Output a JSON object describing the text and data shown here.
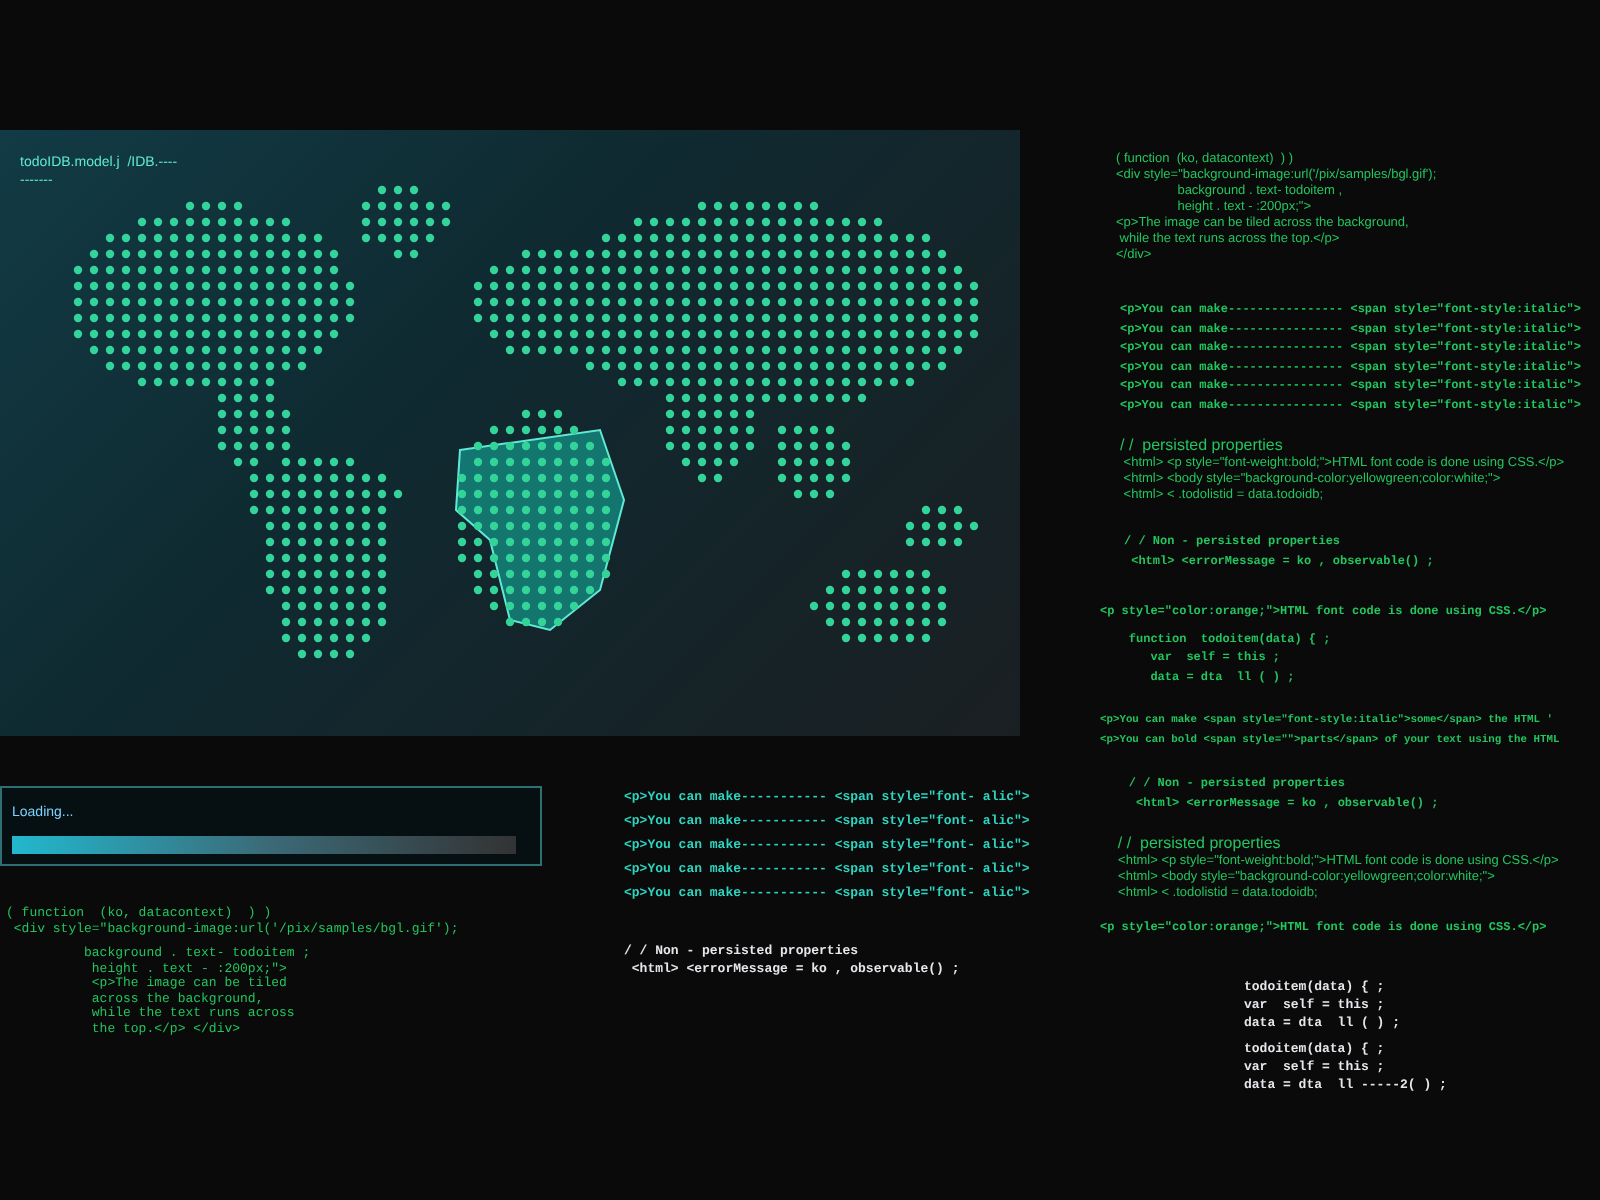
{
  "map_panel": {
    "title": "todoIDB.model.j  /IDB.----",
    "underline": "-------"
  },
  "right_code": [
    {
      "kind": "sans",
      "lines": [
        "( function  (ko, datacontext)  ) )",
        "<div style=\"background-image:url('/pix/samples/bgl.gif');",
        "                 background . text- todoitem ,",
        "                 height . text - :200px;\">",
        "<p>The image can be tiled across the background,",
        " while the text runs across the top.</p>",
        "</div>"
      ]
    },
    {
      "kind": "mono",
      "lines": [
        "<p>You can make---------------- <span style=\"font-style:italic\">",
        "<p>You can make---------------- <span style=\"font-style:italic\">",
        "<p>You can make---------------- <span style=\"font-style:italic\">",
        "<p>You can make---------------- <span style=\"font-style:italic\">",
        "<p>You can make---------------- <span style=\"font-style:italic\">",
        "<p>You can make---------------- <span style=\"font-style:italic\">"
      ]
    },
    {
      "kind": "comment",
      "lines": [
        "/ /  persisted properties",
        " <html> <p style=\"font-weight:bold;\">HTML font code is done using CSS.</p>",
        " <html> <body style=\"background-color:yellowgreen;color:white;\">",
        " <html> < .todolistid = data.todoidb;"
      ]
    },
    {
      "kind": "mono",
      "lines": [
        "/ / Non - persisted properties",
        " <html> <errorMessage = ko , observable() ;"
      ]
    },
    {
      "kind": "mono",
      "lines": [
        "<p style=\"color:orange;\">HTML font code is done using CSS.</p>"
      ]
    },
    {
      "kind": "mono",
      "lines": [
        "    function  todoitem(data) { ;",
        "       var  self = this ;",
        "       data = dta  ll ( ) ;"
      ]
    },
    {
      "kind": "small",
      "lines": [
        "<p>You can make <span style=\"font-style:italic\">some</span> the HTML '",
        "<p>You can bold <span style=\"\">parts</span> of your text using the HTML"
      ]
    },
    {
      "kind": "mono",
      "lines": [
        "    / / Non - persisted properties",
        "     <html> <errorMessage = ko , observable() ;"
      ]
    },
    {
      "kind": "comment",
      "lines": [
        "    / /  persisted properties",
        "     <html> <p style=\"font-weight:bold;\">HTML font code is done using CSS.</p>",
        "     <html> <body style=\"background-color:yellowgreen;color:white;\">",
        "     <html> < .todolistid = data.todoidb;"
      ]
    },
    {
      "kind": "mono",
      "lines": [
        "<p style=\"color:orange;\">HTML font code is done using CSS.</p>"
      ]
    },
    {
      "kind": "light",
      "lines": [
        "todoitem(data) { ;",
        "var  self = this ;",
        "data = dta  ll ( ) ;"
      ]
    },
    {
      "kind": "light",
      "lines": [
        "todoitem(data) { ;",
        "var  self = this ;",
        "data = dta  ll -----2( ) ;"
      ]
    }
  ],
  "loading": {
    "label": "Loading...",
    "level": 1
  },
  "left_code": [
    "( function  (ko, datacontext)  ) )",
    " <div style=\"background-image:url('/pix/samples/bgl.gif');",
    "          background . text- todoitem ;",
    "           height . text - :200px;\">",
    "           <p>The image can be tiled",
    "           across the background,",
    "           while the text runs across",
    "           the top.</p> </div>"
  ],
  "middle_code": [
    {
      "kind": "teal",
      "lines": [
        "<p>You can make----------- <span style=\"font- alic\">",
        "<p>You can make----------- <span style=\"font- alic\">",
        "<p>You can make----------- <span style=\"font- alic\">",
        "<p>You can make----------- <span style=\"font- alic\">",
        "<p>You can make----------- <span style=\"font- alic\">"
      ]
    },
    {
      "kind": "light",
      "lines": [
        "/ / Non - persisted properties",
        " <html> <errorMessage = ko , observable() ;"
      ]
    }
  ]
}
